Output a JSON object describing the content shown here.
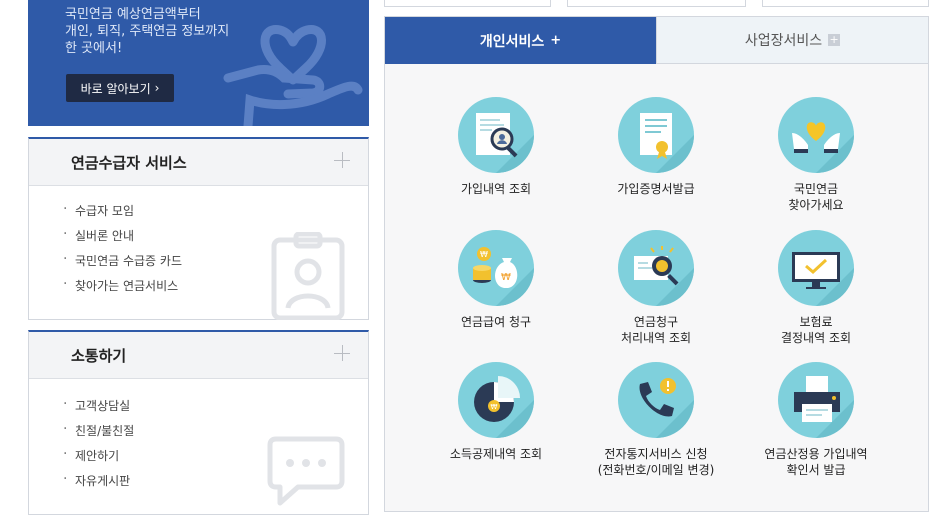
{
  "promo": {
    "lines": [
      "국민연금 예상연금액부터",
      "개인, 퇴직, 주택연금 정보까지",
      "한 곳에서!"
    ],
    "button_label": "바로 알아보기",
    "button_arrow": "›"
  },
  "panels": {
    "recipient": {
      "title": "연금수급자 서비스",
      "items": [
        "수급자 모임",
        "실버론 안내",
        "국민연금 수급증 카드",
        "찾아가는 연금서비스"
      ]
    },
    "communication": {
      "title": "소통하기",
      "items": [
        "고객상담실",
        "친절/불친절",
        "제안하기",
        "자유게시판"
      ]
    }
  },
  "tabs": {
    "personal": {
      "label": "개인서비스",
      "plus": "+"
    },
    "business": {
      "label": "사업장서비스",
      "plus": "+"
    }
  },
  "services": [
    {
      "label": "가입내역 조회",
      "icon": "document-search-icon"
    },
    {
      "label": "가입증명서발급",
      "icon": "certificate-icon"
    },
    {
      "label": "국민연금\n찾아가세요",
      "icon": "heart-hands-icon"
    },
    {
      "label": "연금급여 청구",
      "icon": "coins-bag-icon"
    },
    {
      "label": "연금청구\n처리내역 조회",
      "icon": "document-magnifier-icon"
    },
    {
      "label": "보험료\n결정내역 조회",
      "icon": "monitor-check-icon"
    },
    {
      "label": "소득공제내역 조회",
      "icon": "pie-chart-icon"
    },
    {
      "label": "전자통지서비스 신청\n(전화번호/이메일 변경)",
      "icon": "phone-alert-icon"
    },
    {
      "label": "연금산정용 가입내역\n확인서 발급",
      "icon": "printer-icon"
    }
  ],
  "colors": {
    "brand_blue": "#2f5aa8",
    "icon_circle": "#7fd0dc",
    "panel_bg": "#f3f4f6"
  }
}
